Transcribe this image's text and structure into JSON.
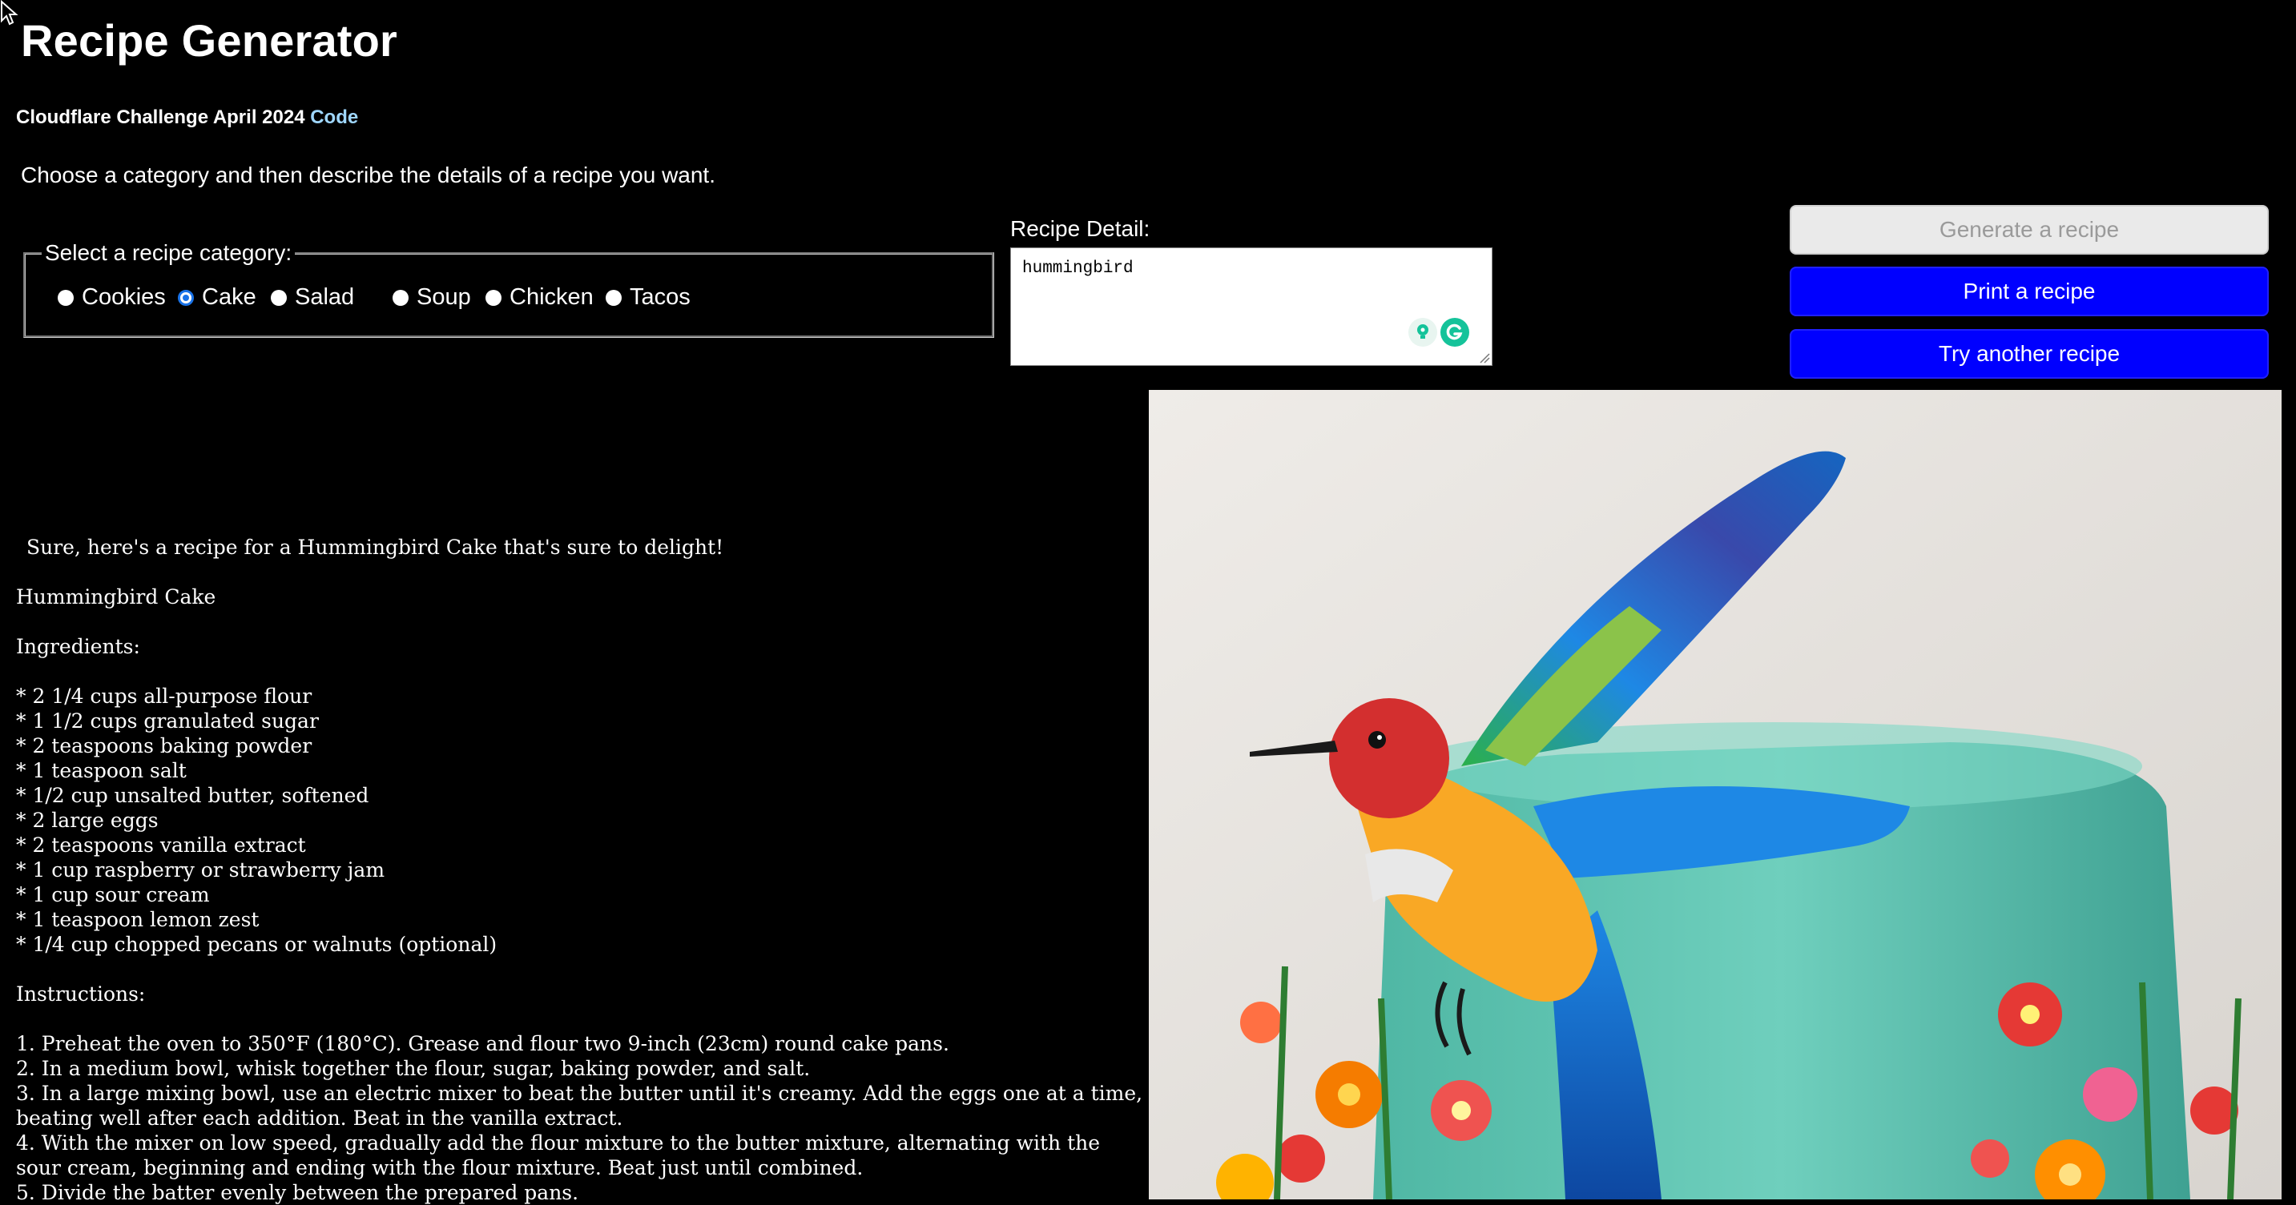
{
  "header": {
    "title": "Recipe Generator",
    "challenge_text": "Cloudflare Challenge April 2024",
    "code_link": "Code"
  },
  "intro": "Choose a category and then describe the details of a recipe you want.",
  "category": {
    "legend": "Select a recipe category:",
    "options": [
      {
        "label": "Cookies",
        "checked": false
      },
      {
        "label": "Cake",
        "checked": true
      },
      {
        "label": "Salad",
        "checked": false
      },
      {
        "label": "Soup",
        "checked": false
      },
      {
        "label": "Chicken",
        "checked": false
      },
      {
        "label": "Tacos",
        "checked": false
      }
    ]
  },
  "detail": {
    "label": "Recipe Detail:",
    "value": "hummingbird"
  },
  "buttons": {
    "generate": "Generate a recipe",
    "print": "Print a recipe",
    "another": "Try another recipe"
  },
  "recipe": {
    "intro": "Sure, here's a recipe for a Hummingbird Cake that's sure to delight!",
    "title": "Hummingbird Cake",
    "ingredients_heading": "Ingredients:",
    "ingredients": [
      "* 2 1/4 cups all-purpose flour",
      "* 1 1/2 cups granulated sugar",
      "* 2 teaspoons baking powder",
      "* 1 teaspoon salt",
      "* 1/2 cup unsalted butter, softened",
      "* 2 large eggs",
      "* 2 teaspoons vanilla extract",
      "* 1 cup raspberry or strawberry jam",
      "* 1 cup sour cream",
      "* 1 teaspoon lemon zest",
      "* 1/4 cup chopped pecans or walnuts (optional)"
    ],
    "instructions_heading": "Instructions:",
    "instructions": [
      "1. Preheat the oven to 350°F (180°C). Grease and flour two 9-inch (23cm) round cake pans.",
      "2. In a medium bowl, whisk together the flour, sugar, baking powder, and salt.",
      "3. In a large mixing bowl, use an electric mixer to beat the butter until it's creamy. Add the eggs one at a time, beating well after each addition. Beat in the vanilla extract.",
      "4. With the mixer on low speed, gradually add the flour mixture to the butter mixture, alternating with the sour cream, beginning and ending with the flour mixture. Beat just until combined.",
      "5. Divide the batter evenly between the prepared pans."
    ]
  },
  "icons": {
    "cursor": "arrow-cursor-icon",
    "grammarly_bulb": "lightbulb-icon",
    "grammarly_logo": "grammarly-icon"
  }
}
